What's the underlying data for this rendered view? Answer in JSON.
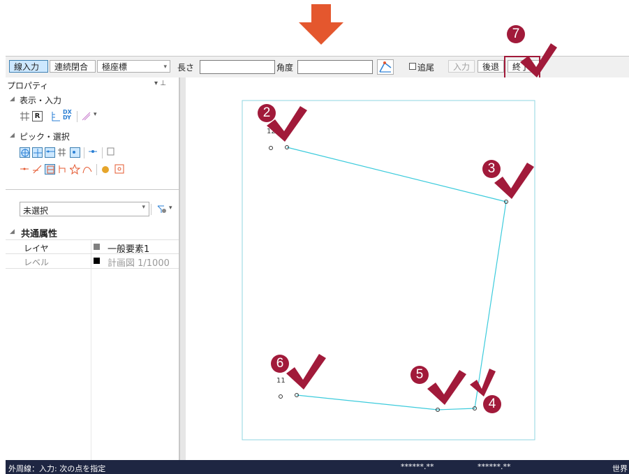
{
  "toolbar": {
    "line_input": "線入力",
    "continuous_close": "連続閉合",
    "coord_mode": "極座標",
    "length_label": "長さ",
    "length_value": "",
    "angle_label": "角度",
    "angle_value": "",
    "follow_label": "追尾",
    "input_button": "入力",
    "back_button": "後退",
    "finish_button": "終了"
  },
  "panel": {
    "title": "プロパティ",
    "section_display": "表示・入力",
    "section_pick": "ピック・選択",
    "selection_value": "未選択",
    "common_attrs": "共通属性",
    "props": [
      {
        "name": "レイヤ",
        "value": "一般要素1",
        "swatch": "#7f7f7f"
      },
      {
        "name": "レベル",
        "value": "計画図 1/1000",
        "swatch": "#000000"
      }
    ]
  },
  "canvas": {
    "label_12": "12",
    "label_11": "11"
  },
  "steps": {
    "s2": "2",
    "s3": "3",
    "s4": "4",
    "s5": "5",
    "s6": "6",
    "s7": "7"
  },
  "statusbar": {
    "message": "外周線：入力: 次の点を指定",
    "coord1": "******.**",
    "coord2": "******.**",
    "world": "世界"
  },
  "colors": {
    "arrow": "#e4572e",
    "badge": "#a11a3a",
    "polyline": "#3ccbdc",
    "statusbar": "#1e2642"
  }
}
